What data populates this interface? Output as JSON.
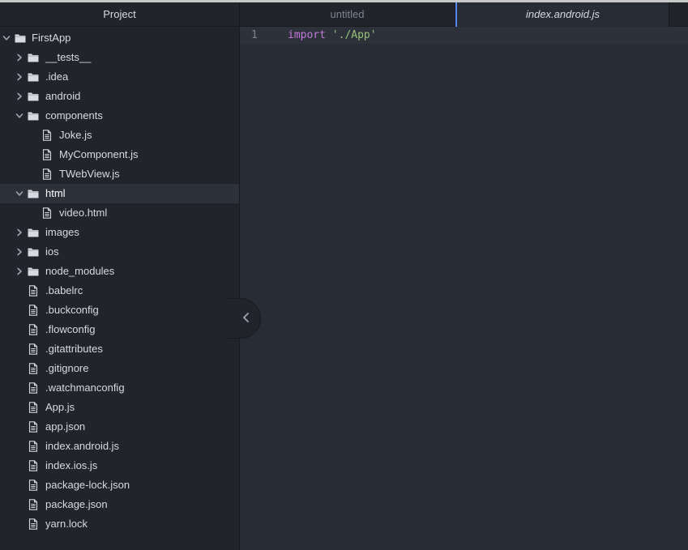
{
  "sidebar": {
    "title": "Project",
    "tree": [
      {
        "label": "FirstApp",
        "kind": "folder",
        "level": 0,
        "expanded": true
      },
      {
        "label": "__tests__",
        "kind": "folder",
        "level": 1,
        "expanded": false
      },
      {
        "label": ".idea",
        "kind": "folder",
        "level": 1,
        "expanded": false
      },
      {
        "label": "android",
        "kind": "folder",
        "level": 1,
        "expanded": false
      },
      {
        "label": "components",
        "kind": "folder",
        "level": 1,
        "expanded": true
      },
      {
        "label": "Joke.js",
        "kind": "file",
        "level": 2
      },
      {
        "label": "MyComponent.js",
        "kind": "file",
        "level": 2
      },
      {
        "label": "TWebView.js",
        "kind": "file",
        "level": 2
      },
      {
        "label": "html",
        "kind": "folder",
        "level": 1,
        "expanded": true,
        "selected": true
      },
      {
        "label": "video.html",
        "kind": "file",
        "level": 2
      },
      {
        "label": "images",
        "kind": "folder",
        "level": 1,
        "expanded": false
      },
      {
        "label": "ios",
        "kind": "folder",
        "level": 1,
        "expanded": false
      },
      {
        "label": "node_modules",
        "kind": "folder",
        "level": 1,
        "expanded": false
      },
      {
        "label": ".babelrc",
        "kind": "file",
        "level": 1
      },
      {
        "label": ".buckconfig",
        "kind": "file",
        "level": 1
      },
      {
        "label": ".flowconfig",
        "kind": "file",
        "level": 1
      },
      {
        "label": ".gitattributes",
        "kind": "file",
        "level": 1
      },
      {
        "label": ".gitignore",
        "kind": "file",
        "level": 1
      },
      {
        "label": ".watchmanconfig",
        "kind": "file",
        "level": 1
      },
      {
        "label": "App.js",
        "kind": "file",
        "level": 1
      },
      {
        "label": "app.json",
        "kind": "file",
        "level": 1
      },
      {
        "label": "index.android.js",
        "kind": "file",
        "level": 1
      },
      {
        "label": "index.ios.js",
        "kind": "file",
        "level": 1
      },
      {
        "label": "package-lock.json",
        "kind": "file",
        "level": 1
      },
      {
        "label": "package.json",
        "kind": "file",
        "level": 1
      },
      {
        "label": "yarn.lock",
        "kind": "file",
        "level": 1
      }
    ]
  },
  "tabs": [
    {
      "label": "untitled",
      "active": false
    },
    {
      "label": "index.android.js",
      "active": true
    }
  ],
  "editor": {
    "lines": [
      {
        "number": "1",
        "keyword": "import",
        "string": "'./App'"
      }
    ]
  },
  "icons": {
    "folder": "folder-icon",
    "file": "file-icon",
    "expanded": "chevron-down-icon",
    "collapsed": "chevron-right-icon",
    "collapse_panel": "chevron-left-icon"
  },
  "colors": {
    "background": "#282c34",
    "sidebar": "#21252b",
    "accent": "#568af2",
    "keyword": "#c678dd",
    "string": "#98c379"
  }
}
